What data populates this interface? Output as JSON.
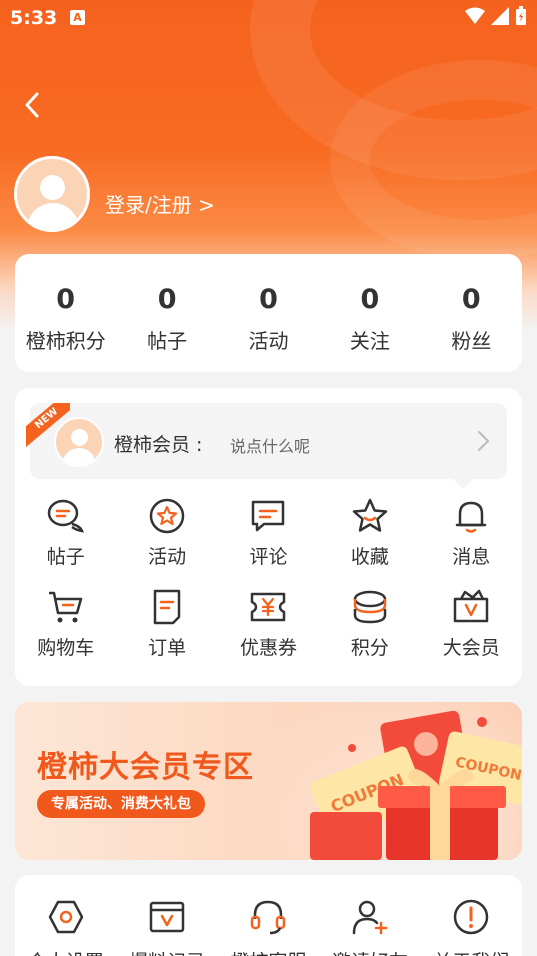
{
  "status_bar": {
    "time": "5:33",
    "notification_icon": "A"
  },
  "header": {
    "login_text": "登录/注册 >"
  },
  "stats": [
    {
      "value": "0",
      "label": "橙柿积分"
    },
    {
      "value": "0",
      "label": "帖子"
    },
    {
      "value": "0",
      "label": "活动"
    },
    {
      "value": "0",
      "label": "关注"
    },
    {
      "value": "0",
      "label": "粉丝"
    }
  ],
  "member": {
    "badge": "NEW",
    "name": "橙柿会员 :",
    "prompt": "说点什么呢"
  },
  "grid": [
    {
      "label": "帖子",
      "icon": "chat-bubbles-icon"
    },
    {
      "label": "活动",
      "icon": "star-badge-icon"
    },
    {
      "label": "评论",
      "icon": "comment-icon"
    },
    {
      "label": "收藏",
      "icon": "star-icon"
    },
    {
      "label": "消息",
      "icon": "bell-icon"
    },
    {
      "label": "购物车",
      "icon": "cart-icon"
    },
    {
      "label": "订单",
      "icon": "order-icon"
    },
    {
      "label": "优惠券",
      "icon": "coupon-icon"
    },
    {
      "label": "积分",
      "icon": "coins-icon"
    },
    {
      "label": "大会员",
      "icon": "vip-bag-icon"
    }
  ],
  "banner": {
    "title": "橙柿大会员专区",
    "subtitle": "专属活动、消费大礼包",
    "coupon_text_1": "COUPON",
    "coupon_text_2": "COUPON"
  },
  "bottom_grid": [
    {
      "label": "个人设置",
      "icon": "settings-hex-icon"
    },
    {
      "label": "爆料记录",
      "icon": "record-icon"
    },
    {
      "label": "橙柿客服",
      "icon": "headset-icon"
    },
    {
      "label": "邀请好友",
      "icon": "add-user-icon"
    },
    {
      "label": "关于我们",
      "icon": "info-icon"
    }
  ],
  "colors": {
    "accent": "#f5621e",
    "background": "#f3f3f3"
  }
}
